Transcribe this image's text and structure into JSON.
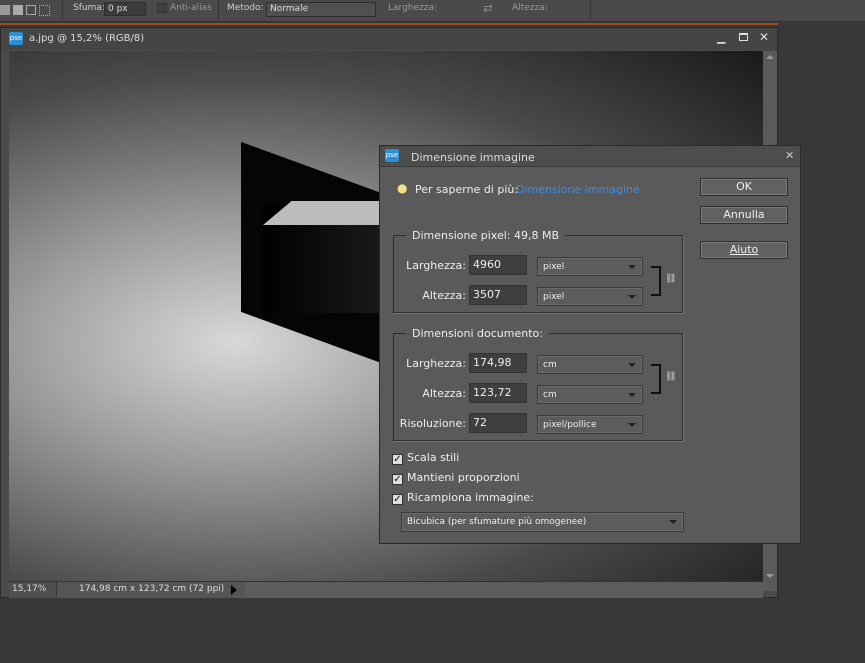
{
  "toolbar": {
    "feather_label": "Sfuma:",
    "feather_value": "0 px",
    "antialias_label": "Anti-alias",
    "method_label": "Metodo:",
    "method_value": "Normale",
    "width_label": "Larghezza:",
    "height_label": "Altezza:"
  },
  "document": {
    "title": "a.jpg @ 15,2% (RGB/8)",
    "zoom": "15,17%",
    "info": "174,98 cm x 123,72 cm (72 ppi)"
  },
  "dialog": {
    "title": "Dimensione immagine",
    "learn_prefix": "Per saperne di più:",
    "learn_link": "Dimensione immagine",
    "ok": "OK",
    "cancel": "Annulla",
    "help": "Aiuto",
    "pixel_group": {
      "label": "Dimensione pixel:",
      "size": "49,8 MB",
      "width_label": "Larghezza:",
      "width": "4960",
      "width_unit": "pixel",
      "height_label": "Altezza:",
      "height": "3507",
      "height_unit": "pixel"
    },
    "doc_group": {
      "label": "Dimensioni documento:",
      "width_label": "Larghezza:",
      "width": "174,98",
      "width_unit": "cm",
      "height_label": "Altezza:",
      "height": "123,72",
      "height_unit": "cm",
      "res_label": "Risoluzione:",
      "res": "72",
      "res_unit": "pixel/pollice"
    },
    "checkboxes": [
      {
        "label": "Scala stili",
        "checked": true
      },
      {
        "label": "Mantieni proporzioni",
        "checked": true
      },
      {
        "label": "Ricampiona immagine:",
        "checked": true
      }
    ],
    "resample": "Bicubica (per sfumature più omogenee)"
  },
  "colors": {
    "link": "#3a8ee6",
    "pse": "#2a8fd6"
  }
}
